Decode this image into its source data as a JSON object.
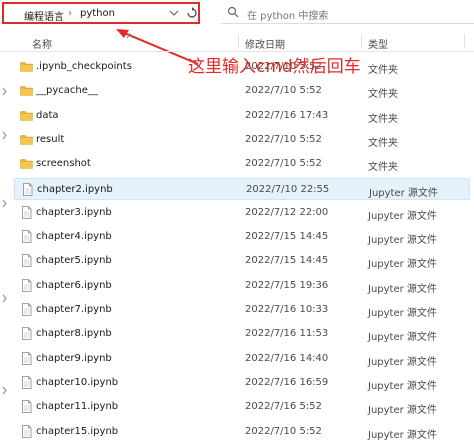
{
  "address": {
    "current": "编程语言",
    "separator": "›",
    "folder": "python"
  },
  "search": {
    "placeholder": "在 python 中搜索"
  },
  "columns": {
    "name": "名称",
    "date": "修改日期",
    "type": "类型"
  },
  "annotation": "这里输入cmd然后回车",
  "files": [
    {
      "name": ".ipynb_checkpoints",
      "date": "2022/7/10 5:52",
      "type": "文件夹",
      "kind": "folder"
    },
    {
      "name": "__pycache__",
      "date": "2022/7/10 5:52",
      "type": "文件夹",
      "kind": "folder"
    },
    {
      "name": "data",
      "date": "2022/7/16 17:43",
      "type": "文件夹",
      "kind": "folder"
    },
    {
      "name": "result",
      "date": "2022/7/10 5:52",
      "type": "文件夹",
      "kind": "folder"
    },
    {
      "name": "screenshot",
      "date": "2022/7/10 5:52",
      "type": "文件夹",
      "kind": "folder"
    },
    {
      "name": "chapter2.ipynb",
      "date": "2022/7/10 22:55",
      "type": "Jupyter 源文件",
      "kind": "file",
      "selected": true
    },
    {
      "name": "chapter3.ipynb",
      "date": "2022/7/12 22:00",
      "type": "Jupyter 源文件",
      "kind": "file"
    },
    {
      "name": "chapter4.ipynb",
      "date": "2022/7/15 14:45",
      "type": "Jupyter 源文件",
      "kind": "file"
    },
    {
      "name": "chapter5.ipynb",
      "date": "2022/7/15 14:45",
      "type": "Jupyter 源文件",
      "kind": "file"
    },
    {
      "name": "chapter6.ipynb",
      "date": "2022/7/15 19:36",
      "type": "Jupyter 源文件",
      "kind": "file"
    },
    {
      "name": "chapter7.ipynb",
      "date": "2022/7/16 10:33",
      "type": "Jupyter 源文件",
      "kind": "file"
    },
    {
      "name": "chapter8.ipynb",
      "date": "2022/7/16 11:53",
      "type": "Jupyter 源文件",
      "kind": "file"
    },
    {
      "name": "chapter9.ipynb",
      "date": "2022/7/16 14:40",
      "type": "Jupyter 源文件",
      "kind": "file"
    },
    {
      "name": "chapter10.ipynb",
      "date": "2022/7/16 16:59",
      "type": "Jupyter 源文件",
      "kind": "file"
    },
    {
      "name": "chapter11.ipynb",
      "date": "2022/7/16 5:52",
      "type": "Jupyter 源文件",
      "kind": "file"
    },
    {
      "name": "chapter15.ipynb",
      "date": "2022/7/10 5:52",
      "type": "Jupyter 源文件",
      "kind": "file"
    }
  ],
  "colors": {
    "highlight": "#e12a2a",
    "folder": "#e8b33a",
    "selected_bg": "#e5f1fb"
  }
}
